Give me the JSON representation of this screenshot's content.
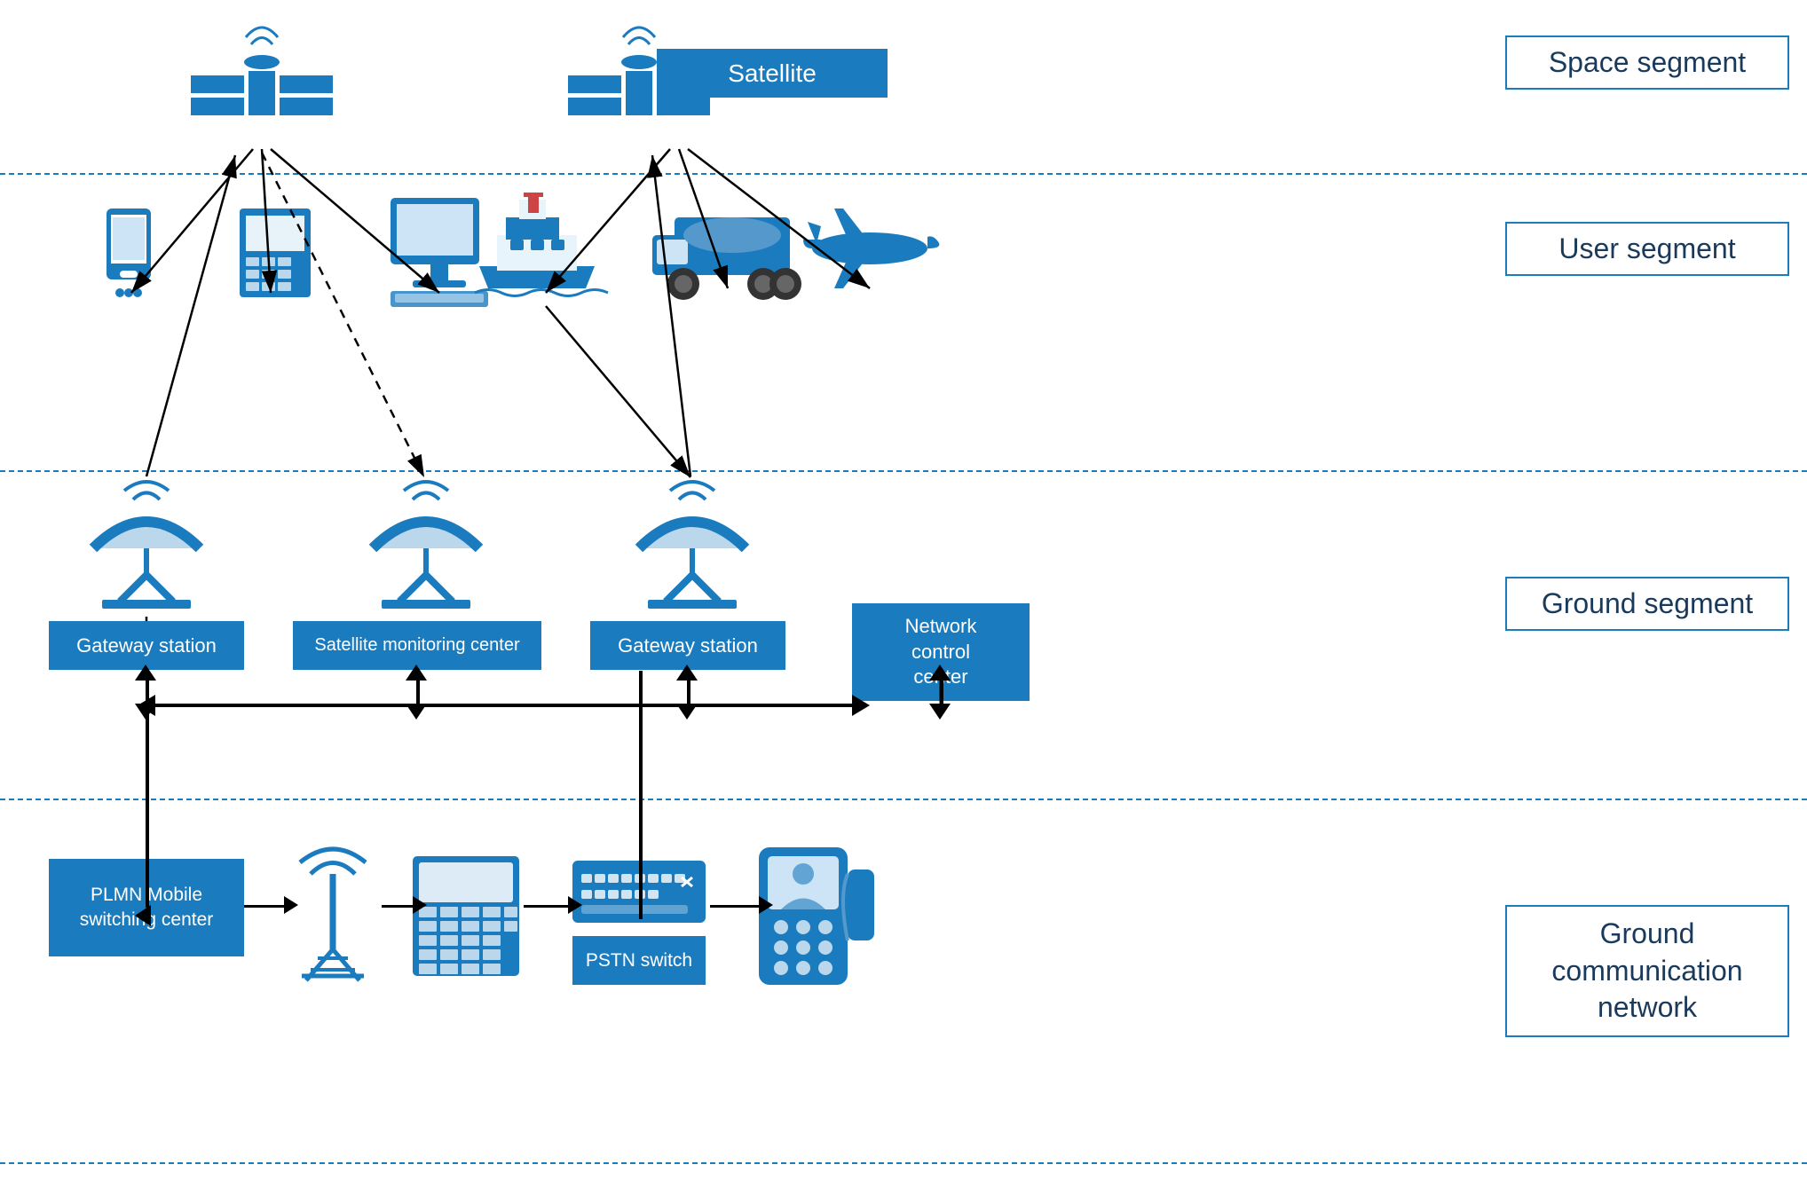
{
  "segments": {
    "space": "Space segment",
    "user": "User segment",
    "ground": "Ground segment",
    "comm": "Ground\ncommunication\nnetwork"
  },
  "labels": {
    "satellite": "Satellite",
    "gateway1": "Gateway station",
    "gateway2": "Gateway station",
    "sat_monitor": "Satellite monitoring center",
    "net_control": "Network\ncontrol\ncenter",
    "plmn": "PLMN Mobile\nswitching center",
    "pstn": "PSTN\nswitch"
  },
  "colors": {
    "blue": "#1a7bbf",
    "dark_blue": "#1a3a5c",
    "dashed": "#1a7bbf"
  }
}
